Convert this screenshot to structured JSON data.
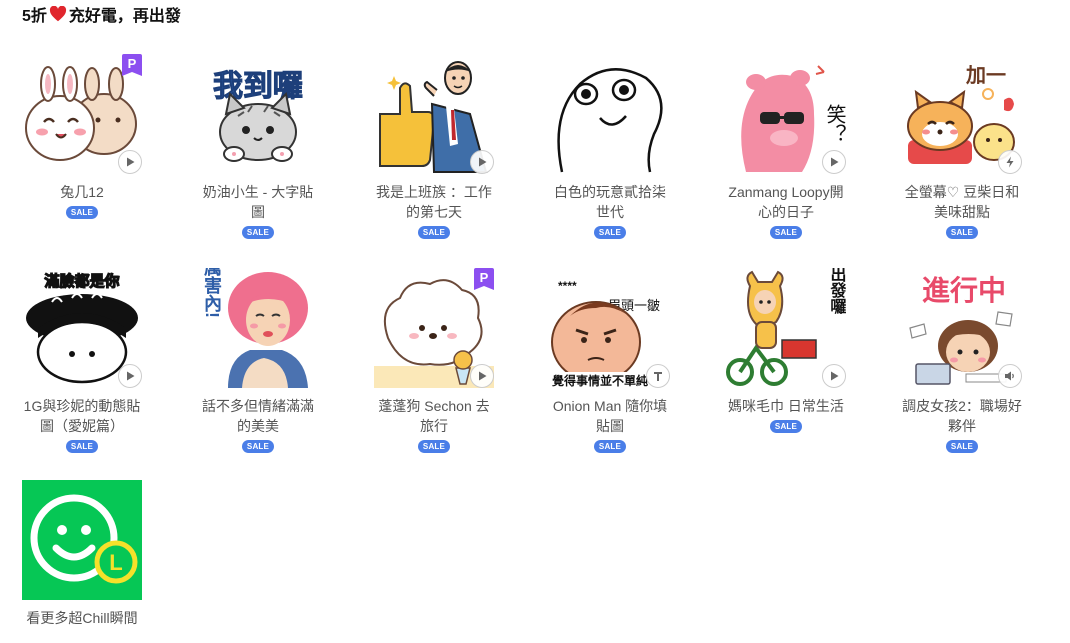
{
  "section": {
    "title_prefix": "5折",
    "title_suffix": "充好電，再出發"
  },
  "sale_label": "SALE",
  "items": [
    {
      "name": "兔几12",
      "badge": "P",
      "control": "play-icon"
    },
    {
      "name": "奶油小生 - 大字貼圖",
      "badge": "",
      "control": ""
    },
    {
      "name": "我是上班族 ：工作的第七天",
      "badge": "",
      "control": "play-icon"
    },
    {
      "name": "白色的玩意貳拾柒世代",
      "badge": "",
      "control": ""
    },
    {
      "name": "Zanmang Loopy開心的日子",
      "badge": "",
      "control": "play-icon"
    },
    {
      "name": "全螢幕♡ 豆柴日和美味甜點",
      "badge": "",
      "control": "lightning-icon"
    },
    {
      "name": "1G與珍妮的動態貼圖（愛妮篇）",
      "badge": "",
      "control": "play-icon"
    },
    {
      "name": "話不多但情緒滿滿的美美",
      "badge": "",
      "control": ""
    },
    {
      "name": "蓬蓬狗 Sechon 去旅行",
      "badge": "P",
      "control": "play-icon"
    },
    {
      "name": "Onion Man 隨你填貼圖",
      "badge": "",
      "control": "text-icon"
    },
    {
      "name": "媽咪毛巾 日常生活",
      "badge": "",
      "control": "play-icon"
    },
    {
      "name": "調皮女孩2：職場好夥伴",
      "badge": "",
      "control": "sound-icon"
    }
  ],
  "sticker_text": {
    "item2": "我到囉",
    "item5": "笑？",
    "item6": "加一",
    "item7": "滿臉都是你",
    "item8": "厲害內!",
    "item10_top": "眉頭一皺",
    "item10_bottom": "覺得事情並不單純",
    "item10_stars": "****",
    "item11": "準備出發囉",
    "item12": "進行中"
  },
  "more": {
    "label": "看更多超Chill瞬間",
    "icon_letter": "L"
  }
}
